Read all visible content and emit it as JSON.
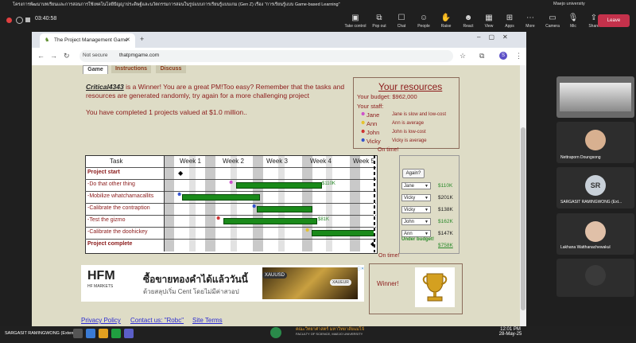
{
  "meeting": {
    "title": "โครงการพัฒนาบทเรียนและการสอนการใช้เทคโนโลยีปัญญาประดิษฐ์และนวัตกรรมการสอนในรูปแบบการเรียนรู้แบบเกม (Gen Z) เรื่อง \"การเรียนรู้แบบ Game-based Learning\"",
    "timer": "03:40:58",
    "org": "Maejo university",
    "toolbar": [
      {
        "icon": "take-control-icon",
        "glyph": "▣",
        "label": "Take control"
      },
      {
        "icon": "pop-out-icon",
        "glyph": "⧉",
        "label": "Pop out"
      },
      {
        "icon": "chat-icon",
        "glyph": "☐",
        "label": "Chat"
      },
      {
        "icon": "people-icon",
        "glyph": "☺",
        "label": "People"
      },
      {
        "icon": "raise-hand-icon",
        "glyph": "✋",
        "label": "Raise"
      },
      {
        "icon": "react-icon",
        "glyph": "☻",
        "label": "React"
      },
      {
        "icon": "view-icon",
        "glyph": "▦",
        "label": "View"
      },
      {
        "icon": "apps-icon",
        "glyph": "⊞",
        "label": "Apps"
      },
      {
        "icon": "more-icon",
        "glyph": "⋯",
        "label": "More"
      },
      {
        "icon": "camera-icon",
        "glyph": "▭",
        "label": "Camera"
      },
      {
        "icon": "mic-icon",
        "glyph": "🎙",
        "label": "Mic"
      },
      {
        "icon": "share-icon",
        "glyph": "⇪",
        "label": "Share"
      }
    ],
    "leave": "Leave"
  },
  "browser": {
    "tab_title": "The Project Management Game",
    "not_secure": "Not secure",
    "url": "thatpmgame.com",
    "profile": "S"
  },
  "game": {
    "tabs": [
      "Game",
      "Instructions",
      "Discuss"
    ],
    "player": "Critical4343",
    "winner_text": " is a Winner! You are a great PM!Too easy? Remember that the tasks and resources are generated randomly, try again for a more challenging project",
    "completed": "You have completed 1 projects valued at $1.0 million..",
    "resources": {
      "title": "Your resources",
      "budget_label": "Your budget:",
      "budget": "$962,000",
      "staff_label": "Your staff:",
      "staff": [
        {
          "name": "Jane",
          "desc": "Jane is slow and low-cost",
          "color": "#cc44cc"
        },
        {
          "name": "Ann",
          "desc": "Ann is average",
          "color": "#e6c020"
        },
        {
          "name": "John",
          "desc": "John is low-cost",
          "color": "#cc2222"
        },
        {
          "name": "Vicky",
          "desc": "Vicky is average",
          "color": "#2244cc"
        }
      ]
    },
    "on_time": "On time!",
    "gantt": {
      "task_header": "Task",
      "weeks": [
        "Week 1",
        "Week 2",
        "Week 3",
        "Week 4",
        "Week 5"
      ],
      "rows": [
        {
          "task": "Project start",
          "bold": true
        },
        {
          "task": "-Do that other thing",
          "bar_label": "$110K",
          "assignee": "Jane",
          "cost": "$110K",
          "cost_color": "#2a8a2a"
        },
        {
          "task": "-Mobilize whatchamacallits",
          "assignee": "Vicky",
          "cost": "$201K",
          "cost_color": "#222"
        },
        {
          "task": "-Calibrate the contraption",
          "assignee": "Vicky",
          "cost": "$138K",
          "cost_color": "#222"
        },
        {
          "task": "-Test the gizmo",
          "bar_label": "$81K",
          "assignee": "John",
          "cost": "$162K",
          "cost_color": "#2a8a2a"
        },
        {
          "task": "-Calibrate the doohickey",
          "assignee": "Ann",
          "cost": "$147K",
          "cost_color": "#222"
        },
        {
          "task": "Project complete",
          "bold": true
        }
      ]
    },
    "again": "Again?",
    "under_budget": "Under budget!",
    "total": "$758K",
    "winner_label": "Winner!"
  },
  "ad": {
    "logo": "HFM",
    "logo_sub": "HF MARKETS",
    "main": "ซื้อขายทองคำได้แล้ววันนี้",
    "sub": "ด้วยสลุปเริ่ม Cent โดยไม่มีค่าสวอป",
    "chip1": "XAUUSD",
    "chip2": "XAUEUR"
  },
  "footer_links": [
    "Privacy Policy",
    "Contact us: \"Robc\"",
    "Site Terms"
  ],
  "participants": [
    {
      "name": "Nettraporn Doungsong",
      "kind": "photo"
    },
    {
      "name": "SARGASIT RAMINGWONG (Ext...",
      "kind": "initials",
      "initials": "SR"
    },
    {
      "name": "Lakhana Watthanachewakul",
      "kind": "photo"
    }
  ],
  "taskbar": {
    "user": "SARGASIT RAMINGWONG (External)",
    "faculty": "คณะวิทยาศาสตร์ มหาวิทยาลัยแม่โจ้",
    "faculty_en": "FACULTY OF SCIENCE, MAEJO UNIVERSITY",
    "time": "12:01 PM",
    "date": "28-May-25"
  }
}
